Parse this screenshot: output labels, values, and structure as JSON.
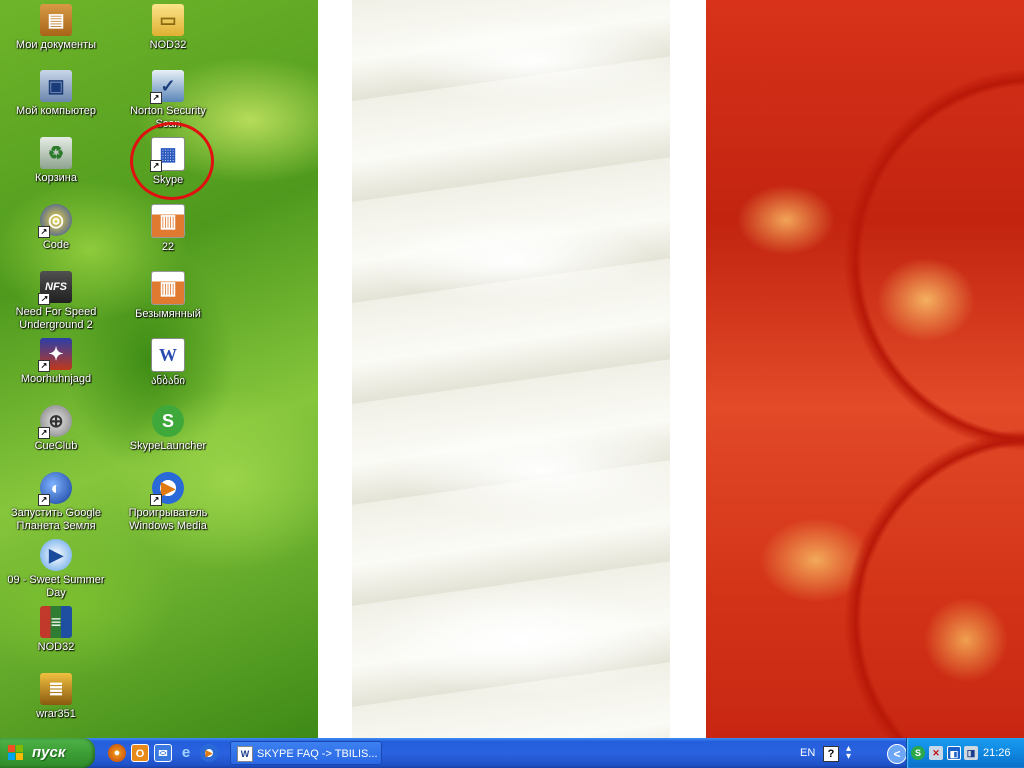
{
  "desktop": {
    "icons": [
      {
        "label": "Мои документы",
        "icon": "folder-docs-icon"
      },
      {
        "label": "Мой компьютер",
        "icon": "computer-icon"
      },
      {
        "label": "Корзина",
        "icon": "recycle-bin-icon"
      },
      {
        "label": "Code",
        "icon": "code-app-icon"
      },
      {
        "label": "Need For Speed Underground 2",
        "icon": "nfs-game-icon"
      },
      {
        "label": "Moorhuhnjagd",
        "icon": "moorhuhn-game-icon"
      },
      {
        "label": "CueClub",
        "icon": "cueclub-game-icon"
      },
      {
        "label": "Запустить Google Планета Земля",
        "icon": "google-earth-icon"
      },
      {
        "label": "09 - Sweet Summer Day",
        "icon": "media-file-icon"
      },
      {
        "label": "NOD32",
        "icon": "winrar-archive-icon"
      },
      {
        "label": "wrar351",
        "icon": "winrar-installer-icon"
      },
      {
        "label": "NOD32",
        "icon": "folder-icon"
      },
      {
        "label": "Norton Security Scan",
        "icon": "norton-icon"
      },
      {
        "label": "Skype",
        "icon": "skype-shortcut-icon"
      },
      {
        "label": "22",
        "icon": "image-file-icon"
      },
      {
        "label": "Безымянный",
        "icon": "image-file-icon"
      },
      {
        "label": "ანბანი",
        "icon": "word-document-icon"
      },
      {
        "label": "SkypeLauncher",
        "icon": "skype-launcher-icon"
      },
      {
        "label": "Проигрыватель Windows Media",
        "icon": "windows-media-player-icon"
      }
    ]
  },
  "taskbar": {
    "start_label": "пуск",
    "quick_launch": [
      "firefox-icon",
      "opera-icon",
      "outlook-express-icon",
      "internet-explorer-icon",
      "media-player-icon"
    ],
    "task_item": "SKYPE FAQ -> TBILIS...",
    "language": "EN",
    "help_glyph": "?",
    "tray_chevron": "<",
    "clock": "21:26"
  },
  "colors": {
    "taskbar": "#245edb",
    "start": "#3c9e35",
    "tray": "#0f87e0",
    "annotation": "#e01010"
  }
}
